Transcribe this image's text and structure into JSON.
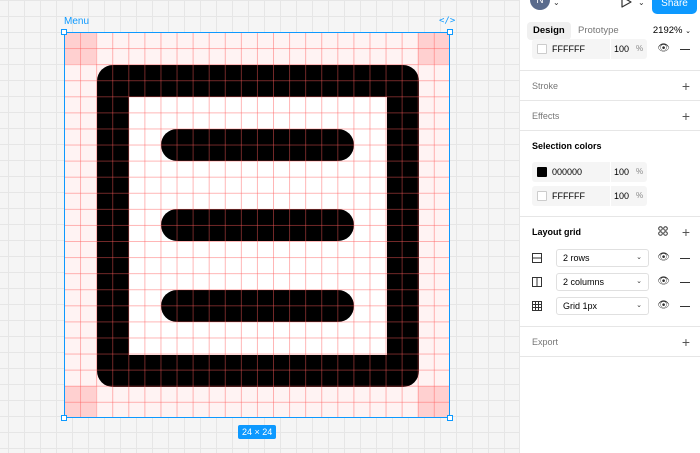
{
  "canvas": {
    "frame_name": "Menu",
    "code_icon": "</>",
    "size_badge": "24 × 24"
  },
  "header": {
    "avatar_initial": "N",
    "share_label": "Share",
    "avatar_color": "#5a6b8c",
    "accent": "#0d99ff"
  },
  "tabs": {
    "design": "Design",
    "prototype": "Prototype",
    "zoom": "2192%"
  },
  "fill": {
    "hex": "FFFFFF",
    "opacity": "100",
    "unit": "%"
  },
  "sections": {
    "stroke": "Stroke",
    "effects": "Effects",
    "selection_colors": "Selection colors",
    "layout_grid": "Layout grid",
    "export": "Export"
  },
  "selection_colors": [
    {
      "hex": "000000",
      "opacity": "100",
      "unit": "%",
      "color": "#000000"
    },
    {
      "hex": "FFFFFF",
      "opacity": "100",
      "unit": "%",
      "color": "#ffffff"
    }
  ],
  "layout_grids": [
    {
      "label": "2 rows",
      "icon": "rows-grid-icon"
    },
    {
      "label": "2 columns",
      "icon": "columns-grid-icon"
    },
    {
      "label": "Grid 1px",
      "icon": "square-grid-icon"
    }
  ]
}
